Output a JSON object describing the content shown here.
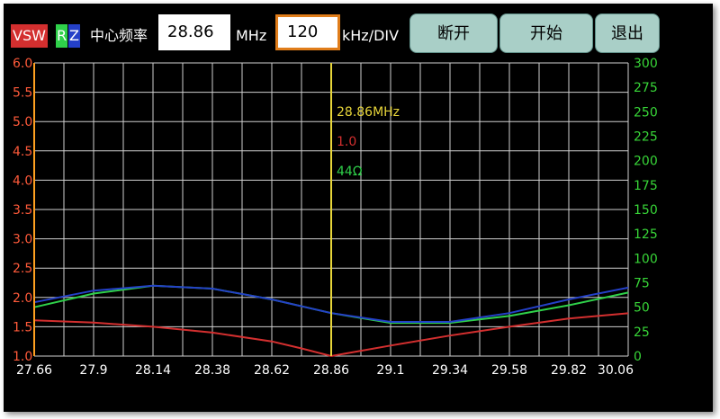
{
  "header": {
    "vsw_tag": "VSW",
    "rz_tag_r": "R",
    "rz_tag_z": "Z",
    "center_label": "中心频率",
    "center_value": "28.86",
    "center_unit": "MHz",
    "span_value": "120",
    "span_unit": "kHz/DIV",
    "disconnect_label": "断开",
    "start_label": "开始",
    "exit_label": "退出"
  },
  "marker": {
    "freq_text": "28.86MHz",
    "swr_text": "1.0",
    "z_text": "44Ω",
    "x": 28.86
  },
  "colors": {
    "vsw": "#d32f2f",
    "r": "#2fd14a",
    "z": "#2440c8",
    "left_axis": "#ff5a3a",
    "right_axis": "#38d638",
    "marker": "#e8d63a",
    "grid": "#d0d0d0"
  },
  "chart_data": {
    "type": "line",
    "xlim": [
      27.66,
      30.06
    ],
    "x_ticks": [
      "27.66",
      "27.9",
      "28.14",
      "28.38",
      "28.62",
      "28.86",
      "29.1",
      "29.34",
      "29.58",
      "29.82",
      "30.06"
    ],
    "y_left_lim": [
      1.0,
      6.0
    ],
    "y_left_ticks": [
      "1.0",
      "1.5",
      "2.0",
      "2.5",
      "3.0",
      "3.5",
      "4.0",
      "4.5",
      "5.0",
      "5.5",
      "6.0"
    ],
    "y_right_lim": [
      0,
      300
    ],
    "y_right_ticks": [
      "0",
      "25",
      "50",
      "75",
      "100",
      "125",
      "150",
      "175",
      "200",
      "225",
      "250",
      "275",
      "300"
    ],
    "grid": true,
    "series": [
      {
        "name": "VSW",
        "axis": "left",
        "color": "#d32f2f",
        "x": [
          27.66,
          27.9,
          28.14,
          28.38,
          28.62,
          28.74,
          28.86,
          29.1,
          29.34,
          29.58,
          29.82,
          30.06
        ],
        "values": [
          1.61,
          1.57,
          1.5,
          1.4,
          1.25,
          1.13,
          1.0,
          1.18,
          1.35,
          1.5,
          1.64,
          1.73
        ]
      },
      {
        "name": "R",
        "axis": "right",
        "color": "#2fd14a",
        "x": [
          27.66,
          27.9,
          28.14,
          28.38,
          28.62,
          28.86,
          29.1,
          29.34,
          29.58,
          29.82,
          30.06
        ],
        "values": [
          50,
          64,
          72,
          69,
          58,
          44,
          34,
          34,
          41,
          52,
          65
        ]
      },
      {
        "name": "Z",
        "axis": "right",
        "color": "#2440c8",
        "x": [
          27.66,
          27.9,
          28.14,
          28.38,
          28.62,
          28.86,
          29.1,
          29.34,
          29.58,
          29.82,
          30.06
        ],
        "values": [
          55,
          67,
          72,
          69,
          58,
          44,
          35,
          35,
          44,
          58,
          70
        ]
      }
    ]
  }
}
